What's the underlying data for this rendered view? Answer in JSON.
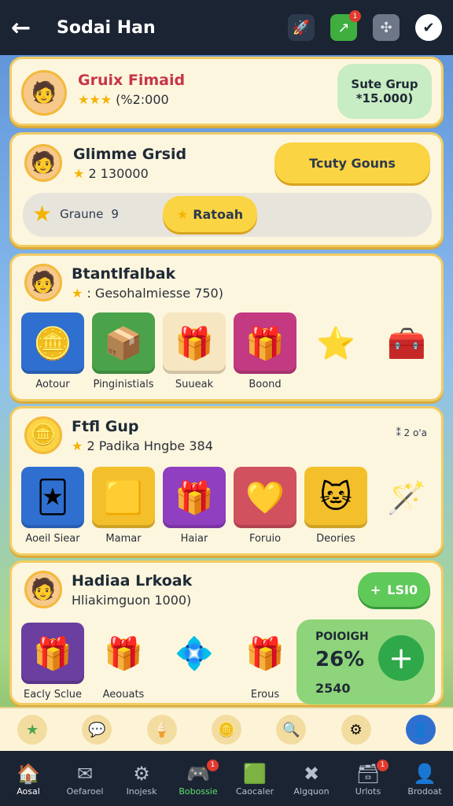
{
  "topbar": {
    "back_icon": "←",
    "title": "Sodai Han",
    "icons": [
      {
        "name": "rocket-icon",
        "glyph": "🚀",
        "badge": ""
      },
      {
        "name": "link-icon",
        "glyph": "↗",
        "badge": "1"
      },
      {
        "name": "puzzle-icon",
        "glyph": "✣",
        "badge": ""
      },
      {
        "name": "shield-icon",
        "glyph": "✔",
        "badge": ""
      }
    ]
  },
  "profile": {
    "name": "Gruix Fimaid",
    "stars": "★★★",
    "value": "(%2:000",
    "group_label": "Sute Grup",
    "group_value": "*15.000)"
  },
  "game_card": {
    "title": "Glimme Grsid",
    "score": "2 130000",
    "button": "Tcuty Gouns",
    "group_label": "Graune",
    "group_count": "9",
    "action_label": "Ratoah"
  },
  "section1": {
    "title": "Btantlfalbak",
    "subtitle": ": Gesohalmiesse 750)",
    "items": [
      {
        "label": "Aotour",
        "glyph": "🪙",
        "bg": "#2f6fd0"
      },
      {
        "label": "Pinginistials",
        "glyph": "📦",
        "bg": "#4aa34a"
      },
      {
        "label": "Suueak",
        "glyph": "🎁",
        "bg": "#f7e6c2"
      },
      {
        "label": "Boond",
        "glyph": "🎁",
        "bg": "#c33a82"
      },
      {
        "label": "",
        "glyph": "⭐",
        "bg": "#fdf6df"
      },
      {
        "label": "",
        "glyph": "🧰",
        "bg": "#fdf6df"
      }
    ]
  },
  "section2": {
    "title": "Ftfl Gup",
    "subtitle": "2 Padika Hngbe 384",
    "corner": "⁑ 2 o'a",
    "items": [
      {
        "label": "Aoeil Siear",
        "glyph": "🃏",
        "bg": "#2f6fd0"
      },
      {
        "label": "Mamar",
        "glyph": "🟨",
        "bg": "#f3c02c"
      },
      {
        "label": "Haiar",
        "glyph": "🎁",
        "bg": "#8f3fbf"
      },
      {
        "label": "Foruio",
        "glyph": "💛",
        "bg": "#d1515f"
      },
      {
        "label": "Deories",
        "glyph": "🐱",
        "bg": "#f3c02c"
      },
      {
        "label": "",
        "glyph": "🪄",
        "bg": "#fdf6df"
      }
    ]
  },
  "section3": {
    "title": "Hadiaa Lrkoak",
    "subtitle": "Hliakimguon 1000)",
    "badge": "LSI0",
    "promo_label": "POIOIGH",
    "promo_value": "26%",
    "promo_bottom": "2540",
    "items": [
      {
        "label": "Eacly Sclue",
        "glyph": "🎁",
        "bg": "#6a3fa0"
      },
      {
        "label": "Aeouats",
        "glyph": "🎁",
        "bg": "#fdf6df"
      },
      {
        "label": "",
        "glyph": "💠",
        "bg": "#fdf6df"
      },
      {
        "label": "Erous",
        "glyph": "🎁",
        "bg": "#fdf6df"
      }
    ]
  },
  "actionbar": [
    {
      "name": "star-icon",
      "glyph": "★"
    },
    {
      "name": "chat-icon",
      "glyph": "💬"
    },
    {
      "name": "ice-cream-icon",
      "glyph": "🍦"
    },
    {
      "name": "coin-icon",
      "glyph": "🪙"
    },
    {
      "name": "search-icon",
      "glyph": "🔍"
    },
    {
      "name": "settings-icon",
      "glyph": "⚙"
    },
    {
      "name": "profile-icon",
      "glyph": "👤"
    }
  ],
  "navbar": [
    {
      "label": "Aosal",
      "glyph": "🏠",
      "badge": ""
    },
    {
      "label": "Oefaroel",
      "glyph": "✉",
      "badge": ""
    },
    {
      "label": "Inojesk",
      "glyph": "⚙",
      "badge": ""
    },
    {
      "label": "Bobossie",
      "glyph": "🎮",
      "badge": "1"
    },
    {
      "label": "Caocaler",
      "glyph": "🟩",
      "badge": ""
    },
    {
      "label": "Algquon",
      "glyph": "✖",
      "badge": ""
    },
    {
      "label": "Urlots",
      "glyph": "🗃",
      "badge": "1"
    },
    {
      "label": "Brodoat",
      "glyph": "👤",
      "badge": ""
    }
  ]
}
